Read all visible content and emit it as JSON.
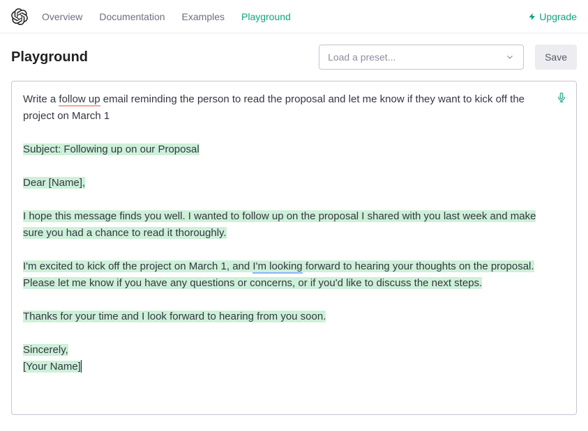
{
  "nav": {
    "overview": "Overview",
    "documentation": "Documentation",
    "examples": "Examples",
    "playground": "Playground",
    "upgrade": "Upgrade"
  },
  "header": {
    "title": "Playground",
    "preset_placeholder": "Load a preset...",
    "save": "Save"
  },
  "editor": {
    "prompt_pre": "Write a ",
    "prompt_spell": "follow up",
    "prompt_post": " email reminding the person to read the proposal and let me know if they want to kick off the project on March 1",
    "gen_subject": "Subject: Following up on our Proposal",
    "gen_greeting": "Dear [Name],",
    "gen_p1": "I hope this message finds you well. I wanted to follow up on the proposal I shared with you last week and make sure you had a chance to read it thoroughly.",
    "gen_p2_a": "I'm excited to kick off the project on March 1, and ",
    "gen_p2_spell": "I'm looking",
    "gen_p2_b": " forward to hearing your thoughts on the proposal. Please let me know if you have any questions or concerns, or if you'd like to discuss the next steps.",
    "gen_p3": "Thanks for your time and I look forward to hearing from you soon.",
    "gen_sign1": "Sincerely,",
    "gen_sign2": "[Your Name]"
  }
}
